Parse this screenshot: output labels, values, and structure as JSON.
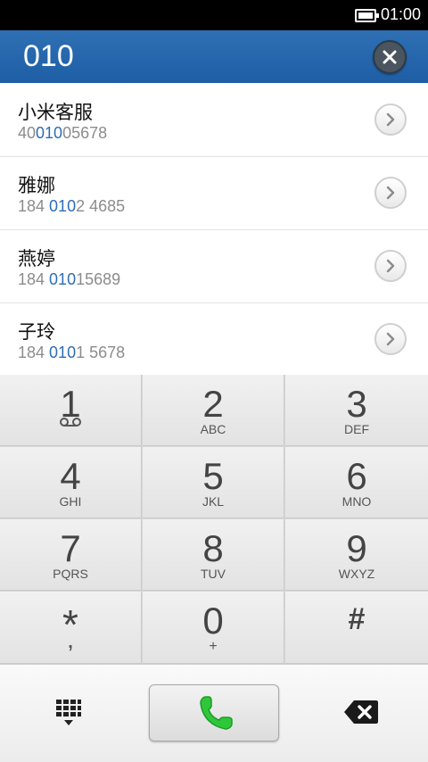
{
  "status_bar": {
    "time": "01:00"
  },
  "header": {
    "number": "010"
  },
  "contacts": [
    {
      "name": "小米客服",
      "phone_pre": "40",
      "phone_match": "010",
      "phone_post": "05678"
    },
    {
      "name": "雅娜",
      "phone_pre": "184 ",
      "phone_match": "010",
      "phone_post": "2 4685"
    },
    {
      "name": "燕婷",
      "phone_pre": "184 ",
      "phone_match": "010",
      "phone_post": "15689"
    },
    {
      "name": "子玲",
      "phone_pre": "184 ",
      "phone_match": "010",
      "phone_post": "1 5678"
    }
  ],
  "keypad": [
    {
      "digit": "1",
      "letters": ""
    },
    {
      "digit": "2",
      "letters": "ABC"
    },
    {
      "digit": "3",
      "letters": "DEF"
    },
    {
      "digit": "4",
      "letters": "GHI"
    },
    {
      "digit": "5",
      "letters": "JKL"
    },
    {
      "digit": "6",
      "letters": "MNO"
    },
    {
      "digit": "7",
      "letters": "PQRS"
    },
    {
      "digit": "8",
      "letters": "TUV"
    },
    {
      "digit": "9",
      "letters": "WXYZ"
    },
    {
      "digit": "*",
      "letters": ","
    },
    {
      "digit": "0",
      "letters": "+"
    },
    {
      "digit": "#",
      "letters": ""
    }
  ],
  "icons": {
    "battery": "battery-icon",
    "clear": "clear-x-icon",
    "chevron": "chevron-right-icon",
    "voicemail": "voicemail-icon",
    "dialpad": "dialpad-grid-icon",
    "call": "phone-call-icon",
    "backspace": "backspace-icon"
  },
  "colors": {
    "header": "#2f6fb3",
    "match": "#2d6db5",
    "call_green": "#2fc73a"
  }
}
